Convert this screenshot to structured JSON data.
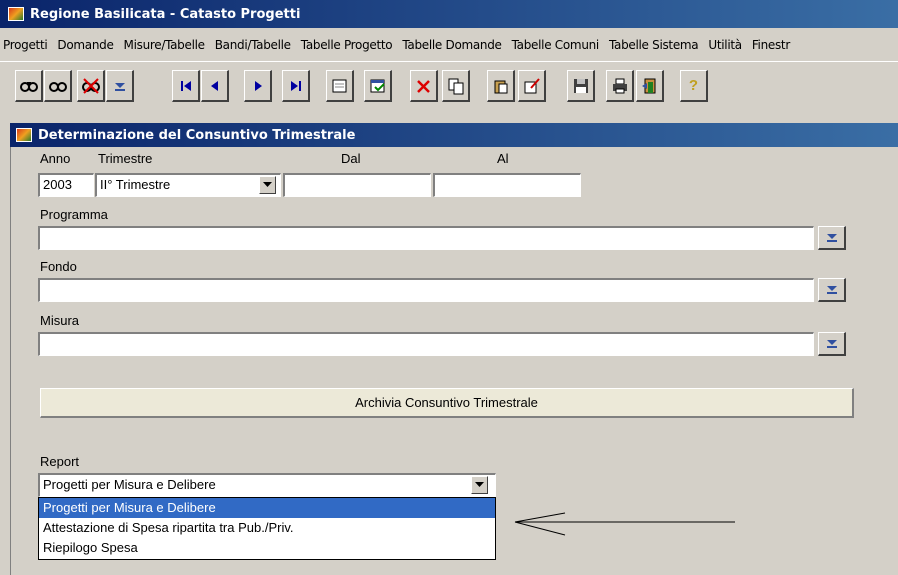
{
  "window": {
    "title": "Regione Basilicata - Catasto Progetti"
  },
  "menu": [
    "Progetti",
    "Domande",
    "Misure/Tabelle",
    "Bandi/Tabelle",
    "Tabelle Progetto",
    "Tabelle Domande",
    "Tabelle Comuni",
    "Tabelle Sistema",
    "Utilità",
    "Finestr"
  ],
  "toolbar": {
    "icons": [
      "find-icon",
      "find-next-icon",
      "clear-query-icon",
      "list-values-icon",
      "first-record-icon",
      "previous-record-icon",
      "next-record-icon",
      "last-record-icon",
      "new-record-icon",
      "edit-record-icon",
      "delete-record-icon",
      "copy-record-icon",
      "paste-icon",
      "edit-field-icon",
      "save-icon",
      "print-icon",
      "exit-icon",
      "help-icon"
    ],
    "help_symbol": "?"
  },
  "form": {
    "title": "Determinazione del Consuntivo Trimestrale",
    "anno_label": "Anno",
    "anno_value": "2003",
    "trimestre_label": "Trimestre",
    "trimestre_value": "II° Trimestre",
    "dal_label": "Dal",
    "dal_value": "",
    "al_label": "Al",
    "al_value": "",
    "programma_label": "Programma",
    "programma_value": "",
    "fondo_label": "Fondo",
    "fondo_value": "",
    "misura_label": "Misura",
    "misura_value": "",
    "archive_button": "Archivia Consuntivo Trimestrale",
    "report_label": "Report",
    "report_value": "Progetti per Misura e Delibere",
    "report_options": [
      "Progetti per Misura e Delibere",
      "Attestazione di Spesa ripartita tra Pub./Priv.",
      "Riepilogo Spesa"
    ],
    "report_selected_index": 0
  },
  "colors": {
    "title_bar": "#0a246a",
    "selection": "#316ac5",
    "window_bg": "#d4d0c8"
  }
}
